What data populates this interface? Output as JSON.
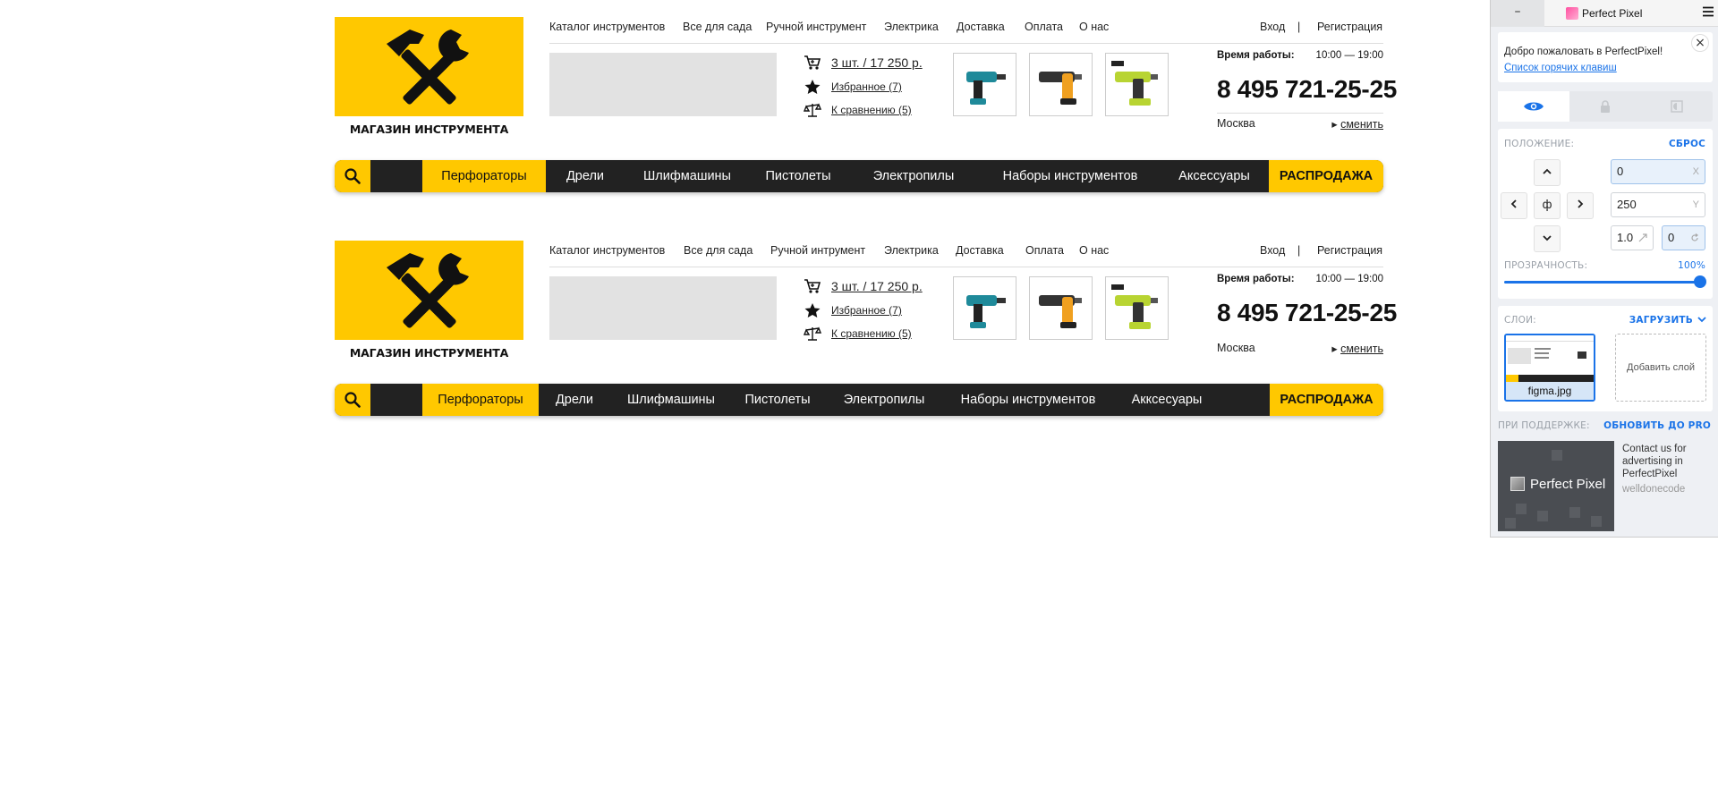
{
  "headers": [
    {
      "logo_caption": "МАГАЗИН ИНСТРУМЕНТА",
      "topnav": [
        "Каталог инструментов",
        "Все для сада",
        "Ручной инструмент",
        "Электрика",
        "Доставка",
        "Оплата",
        "О нас"
      ],
      "login": "Вход",
      "separator": "|",
      "register": "Регистрация",
      "cart": "3 шт. / 17 250 р.",
      "favorites": "Избранное (7)",
      "compare": "К сравнению (5)",
      "hours_label": "Время работы:",
      "hours_value": "10:00 — 19:00",
      "phone": "8 495 721-25-25",
      "city": "Москва",
      "change": "сменить",
      "menu": [
        "Перфораторы",
        "Дрели",
        "Шлифмашины",
        "Пистолеты",
        "Электропилы",
        "Наборы инструментов",
        "Аксессуары"
      ],
      "sale": "РАСПРОДАЖА"
    },
    {
      "logo_caption": "МАГАЗИН ИНСТРУМЕНТА",
      "topnav": [
        "Каталог инструментов",
        "Все для сада",
        "Ручной интрумент",
        "Электрика",
        "Доставка",
        "Оплата",
        "О нас"
      ],
      "login": "Вход",
      "separator": "|",
      "register": "Регистрация",
      "cart": "3 шт. / 17 250 р.",
      "favorites": "Избранное (7)",
      "compare": "К сравнению (5)",
      "hours_label": "Время работы:",
      "hours_value": "10:00 — 19:00",
      "phone": "8 495 721-25-25",
      "city": "Москва",
      "change": "сменить",
      "menu": [
        "Перфораторы",
        "Дрели",
        "Шлифмашины",
        "Пистолеты",
        "Электропилы",
        "Наборы инструментов",
        "Акксесуары"
      ],
      "sale": "РАСПРОДАЖА"
    }
  ],
  "colors": {
    "brand_yellow": "#ffc800",
    "menu_dark": "#222222",
    "pp_blue": "#1a73e8"
  },
  "panel": {
    "minimize": "–",
    "title": "Perfect Pixel",
    "welcome": "Добро пожаловать в PerfectPixel!",
    "hotkeys_link": "Список горячих клавиш",
    "close": "×",
    "position_label": "ПОЛОЖЕНИЕ:",
    "reset": "СБРОС",
    "x_value": "0",
    "x_suffix": "X",
    "y_value": "250",
    "y_suffix": "Y",
    "scale_value": "1.0",
    "rotation_value": "0",
    "center_glyph": "ф",
    "opacity_label": "ПРОЗРАЧНОСТЬ:",
    "opacity_value": "100%",
    "opacity_fraction": 1.0,
    "layers_label": "СЛОИ:",
    "upload": "ЗАГРУЗИТЬ",
    "layer_name": "figma.jpg",
    "add_layer": "Добавить слой",
    "support_label": "ПРИ ПОДДЕРЖКЕ:",
    "upgrade": "ОБНОВИТЬ ДО PRO",
    "ad_brand": "Perfect Pixel",
    "ad_text": "Contact us for advertising in PerfectPixel",
    "ad_sub": "welldonecode"
  }
}
